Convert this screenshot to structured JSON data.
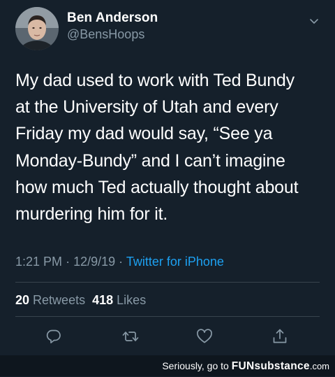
{
  "author": {
    "display_name": "Ben Anderson",
    "handle": "@BensHoops"
  },
  "tweet": {
    "lines": [
      "My dad used to work with Ted Bundy",
      "at the University of Utah and every",
      "Friday my dad would say, “See ya",
      "Monday-Bundy” and I can’t imagine",
      "how much Ted actually thought about",
      "murdering him for it."
    ],
    "time": "1:21 PM",
    "date": "12/9/19",
    "separator": "·",
    "source": "Twitter for iPhone"
  },
  "stats": {
    "retweets_count": "20",
    "retweets_label": "Retweets",
    "likes_count": "418",
    "likes_label": "Likes"
  },
  "actions": {
    "reply_icon": "reply-icon",
    "retweet_icon": "retweet-icon",
    "like_icon": "heart-icon",
    "share_icon": "share-icon"
  },
  "watermark": {
    "prefix": "Seriously, go to",
    "brand_bold": "FUNsubstance",
    "brand_tld": ".com"
  },
  "colors": {
    "background": "#15202b",
    "text_primary": "#ffffff",
    "text_secondary": "#8899a6",
    "link": "#1da1f2",
    "divider": "#38444d"
  }
}
